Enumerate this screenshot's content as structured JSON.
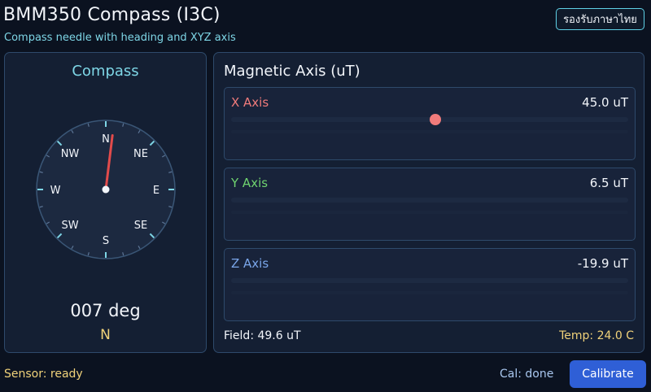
{
  "header": {
    "title": "BMM350 Compass (I3C)",
    "subtitle": "Compass needle with heading and XYZ axis",
    "lang_button": "รองรับภาษาไทย"
  },
  "compass": {
    "title": "Compass",
    "heading_deg": 7,
    "heading_text": "007 deg",
    "direction": "N",
    "cardinals": {
      "n": "N",
      "ne": "NE",
      "e": "E",
      "se": "SE",
      "s": "S",
      "sw": "SW",
      "w": "W",
      "nw": "NW"
    }
  },
  "axis": {
    "title": "Magnetic Axis (uT)",
    "x": {
      "label": "X Axis",
      "value": "45.0 uT",
      "color": "#f07b7b"
    },
    "y": {
      "label": "Y Axis",
      "value": "6.5 uT",
      "color": "#6fd36f"
    },
    "z": {
      "label": "Z Axis",
      "value": "-19.9 uT",
      "color": "#7aa6ea"
    }
  },
  "footer": {
    "field": "Field: 49.6 uT",
    "temp": "Temp: 24.0 C",
    "sensor_status": "Sensor: ready",
    "cal_status": "Cal: done",
    "calibrate_button": "Calibrate"
  },
  "colors": {
    "background": "#0b1220",
    "panel": "#141f33",
    "accent": "#7ed6e6",
    "warn": "#f0d27a",
    "needle": "#e24b4b",
    "button": "#2f5fd6"
  }
}
